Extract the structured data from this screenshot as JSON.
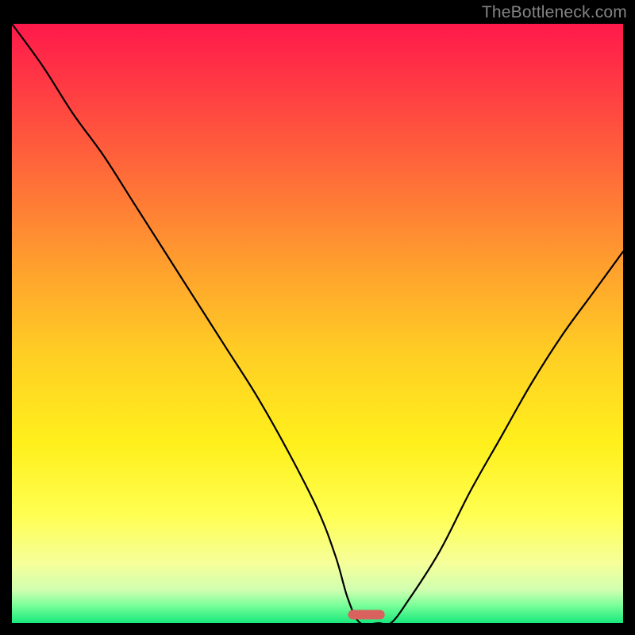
{
  "watermark": "TheBottleneck.com",
  "chart_data": {
    "type": "line",
    "title": "",
    "xlabel": "",
    "ylabel": "",
    "xlim": [
      0,
      100
    ],
    "ylim": [
      0,
      100
    ],
    "x": [
      0,
      5,
      10,
      15,
      20,
      25,
      30,
      35,
      40,
      45,
      50,
      53,
      55,
      57,
      60,
      62,
      65,
      70,
      75,
      80,
      85,
      90,
      95,
      100
    ],
    "values": [
      100,
      93,
      85,
      78,
      70,
      62,
      54,
      46,
      38,
      29,
      19,
      11,
      4,
      0,
      0,
      0,
      4,
      12,
      22,
      31,
      40,
      48,
      55,
      62
    ],
    "background_gradient": {
      "stops": [
        {
          "offset": 0.0,
          "color": "#ff194b"
        },
        {
          "offset": 0.1,
          "color": "#ff3944"
        },
        {
          "offset": 0.25,
          "color": "#ff6b39"
        },
        {
          "offset": 0.4,
          "color": "#ff9e2e"
        },
        {
          "offset": 0.55,
          "color": "#ffce24"
        },
        {
          "offset": 0.7,
          "color": "#fff01c"
        },
        {
          "offset": 0.82,
          "color": "#ffff52"
        },
        {
          "offset": 0.9,
          "color": "#f6ff9a"
        },
        {
          "offset": 0.945,
          "color": "#d0ffb0"
        },
        {
          "offset": 0.97,
          "color": "#7aff9a"
        },
        {
          "offset": 1.0,
          "color": "#18e87b"
        }
      ]
    },
    "marker": {
      "x_center": 58,
      "width": 6,
      "y": 1.4,
      "color": "#d9625f"
    },
    "curve_color": "#000000",
    "curve_width": 2.2
  }
}
